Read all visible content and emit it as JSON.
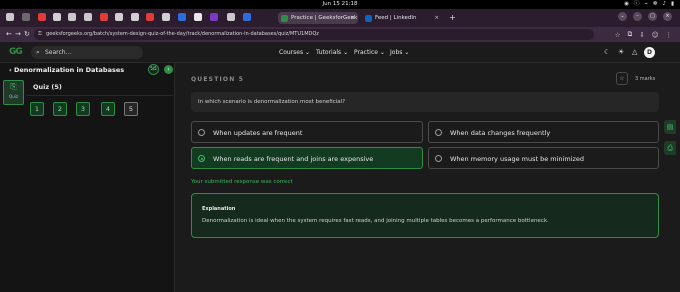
{
  "system": {
    "clock": "Jun 15  21:18",
    "tray": [
      "◉",
      "ⓘ",
      "⌁",
      "❁",
      "♪",
      "▮"
    ]
  },
  "browser": {
    "pinned_colors": [
      "#c9c9c9",
      "#6a6a6a",
      "#e03a3a",
      "#d0d0d0",
      "#c9c9c9",
      "#c9c9c9",
      "#e03a3a",
      "#d0d0d0",
      "#d0d0d0",
      "#e03a3a",
      "#d0d0d0",
      "#2d6cdf",
      "#e8e8e8",
      "#7a3ac4",
      "#c9c9c9",
      "#2d6cdf"
    ],
    "active_tab": {
      "title": "Practice | GeeksforGeek",
      "favicon_color": "#2f8d46"
    },
    "second_tab": {
      "title": "Feed | LinkedIn",
      "favicon_color": "#0a66c2"
    },
    "close_glyph": "×",
    "new_tab_glyph": "+",
    "window_controls": [
      "⌄",
      "–",
      "□",
      "×"
    ],
    "nav": {
      "back": "←",
      "forward": "→",
      "reload": "↻"
    },
    "url": "geeksforgeeks.org/batch/system-design-quiz-of-the-day/track/denormalization-in-databases/quiz/MTU1MDQz",
    "lock_glyph": "⚿",
    "nav_right": [
      "☆",
      "⧉",
      "⇩",
      "☺",
      "⋮"
    ]
  },
  "gfg_header": {
    "logo": "GG",
    "search_placeholder": "Search...",
    "menus": [
      "Courses ⌄",
      "Tutorials ⌄",
      "Practice ⌄",
      "Jobs ⌄"
    ],
    "icons": [
      "☾",
      "☀",
      "△"
    ],
    "avatar_letter": "D"
  },
  "left_panel": {
    "back_title": "‹  Denormalization in Databases",
    "progress_ring_text": "5/5",
    "collapse_glyph": "‹",
    "quiz_tile_label": "Quiz",
    "quiz_tile_icon": "⎘",
    "quiz_name": "Quiz (5)",
    "questions": [
      "1",
      "2",
      "3",
      "4",
      "5"
    ],
    "current_question": "5"
  },
  "question": {
    "label": "QUESTION 5",
    "marks": "3 marks",
    "star_glyph": "☆",
    "text": "In which scenario is denormalization most beneficial?",
    "options": [
      {
        "text": "When updates are frequent",
        "selected": false
      },
      {
        "text": "When data changes frequently",
        "selected": false
      },
      {
        "text": "When reads are frequent and joins are expensive",
        "selected": true
      },
      {
        "text": "When memory usage must be minimized",
        "selected": false
      }
    ],
    "result": "Your submitted response was correct",
    "explanation_title": "Explanation",
    "explanation": "Denormalization is ideal when the system requires fast reads, and joining multiple tables becomes a performance bottleneck."
  },
  "side_buttons": [
    "▤",
    "⎙"
  ]
}
